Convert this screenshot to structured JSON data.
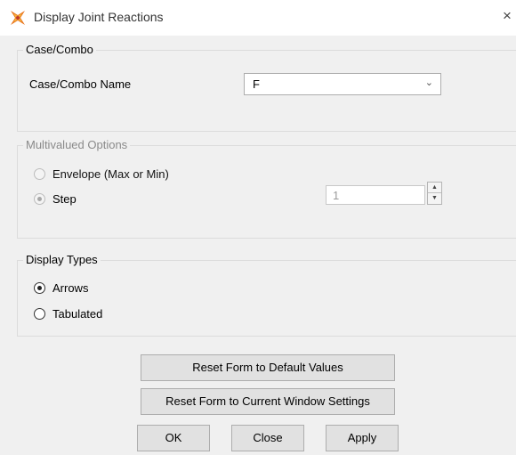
{
  "window": {
    "title": "Display Joint Reactions",
    "close_glyph": "×",
    "icon": "sap-app-icon"
  },
  "case_combo": {
    "group_label": "Case/Combo",
    "name_label": "Case/Combo Name",
    "selected": "F",
    "arrow_glyph": "⌄"
  },
  "multivalued": {
    "group_label": "Multivalued Options",
    "envelope_label": "Envelope (Max or Min)",
    "step_label": "Step",
    "step_value": "1",
    "selected": "step",
    "enabled": false,
    "spin_up": "▲",
    "spin_down": "▼"
  },
  "display_types": {
    "group_label": "Display Types",
    "arrows_label": "Arrows",
    "tabulated_label": "Tabulated",
    "selected": "arrows"
  },
  "buttons": {
    "reset_default": "Reset Form to Default Values",
    "reset_current": "Reset Form to Current Window Settings",
    "ok": "OK",
    "close": "Close",
    "apply": "Apply"
  },
  "colors": {
    "client_bg": "#f0f0f0",
    "button_bg": "#e1e1e1",
    "disabled_text": "#8a8a8a"
  }
}
